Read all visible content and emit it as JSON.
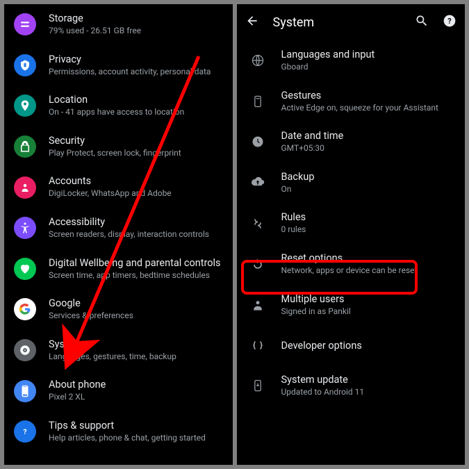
{
  "left": {
    "items": [
      {
        "title": "Storage",
        "sub": "79% used - 26.51 GB free"
      },
      {
        "title": "Privacy",
        "sub": "Permissions, account activity, personal data"
      },
      {
        "title": "Location",
        "sub": "On - 41 apps have access to location"
      },
      {
        "title": "Security",
        "sub": "Play Protect, screen lock, fingerprint"
      },
      {
        "title": "Accounts",
        "sub": "DigiLocker, WhatsApp and Adobe"
      },
      {
        "title": "Accessibility",
        "sub": "Screen readers, display, interaction controls"
      },
      {
        "title": "Digital Wellbeing and parental controls",
        "sub": "Screen time, app timers, bedtime schedules"
      },
      {
        "title": "Google",
        "sub": "Services & preferences"
      },
      {
        "title": "System",
        "sub": "Languages, gestures, time, backup"
      },
      {
        "title": "About phone",
        "sub": "Pixel 2 XL"
      },
      {
        "title": "Tips & support",
        "sub": "Help articles, phone & chat, getting started"
      }
    ]
  },
  "right": {
    "header": "System",
    "items": [
      {
        "title": "Languages and input",
        "sub": "Gboard"
      },
      {
        "title": "Gestures",
        "sub": "Active Edge on, squeeze for your Assistant"
      },
      {
        "title": "Date and time",
        "sub": "GMT+05:30"
      },
      {
        "title": "Backup",
        "sub": "On"
      },
      {
        "title": "Rules",
        "sub": "0 rules"
      },
      {
        "title": "Reset options",
        "sub": "Network, apps or device can be reset"
      },
      {
        "title": "Multiple users",
        "sub": "Signed in as Pankil"
      },
      {
        "title": "Developer options",
        "sub": ""
      },
      {
        "title": "System update",
        "sub": "Updated to Android 11"
      }
    ]
  },
  "annotation": {
    "arrow_target": "System",
    "box_target": "Reset options"
  }
}
